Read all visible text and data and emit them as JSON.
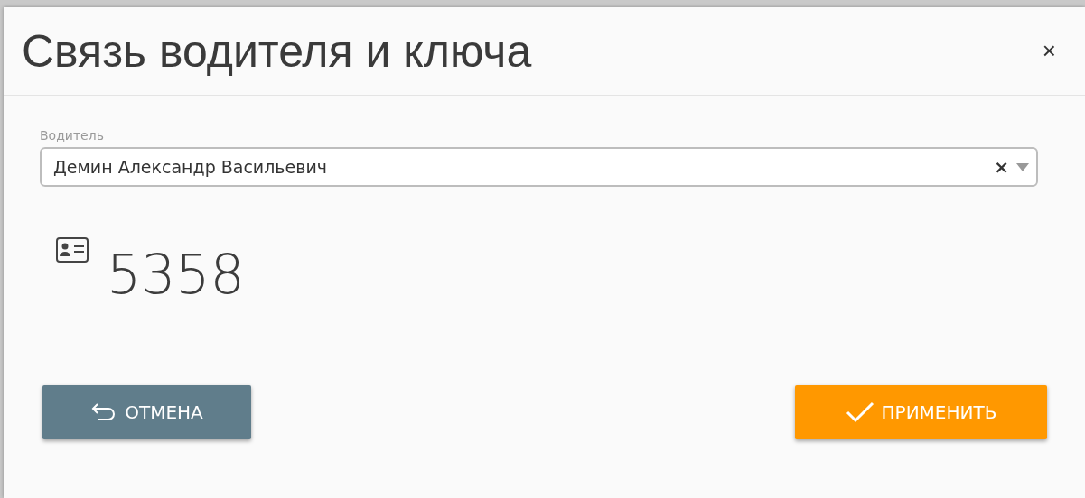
{
  "dialog": {
    "title": "Связь водителя и ключа",
    "close": "×"
  },
  "driver_field": {
    "label": "Водитель",
    "value": "Демин Александр Васильевич",
    "clear": "×"
  },
  "key": {
    "number": "5358"
  },
  "buttons": [
    {
      "kind": "cancel",
      "label": "ОТМЕНА"
    },
    {
      "kind": "apply",
      "label": "ПРИМЕНИТЬ"
    }
  ]
}
